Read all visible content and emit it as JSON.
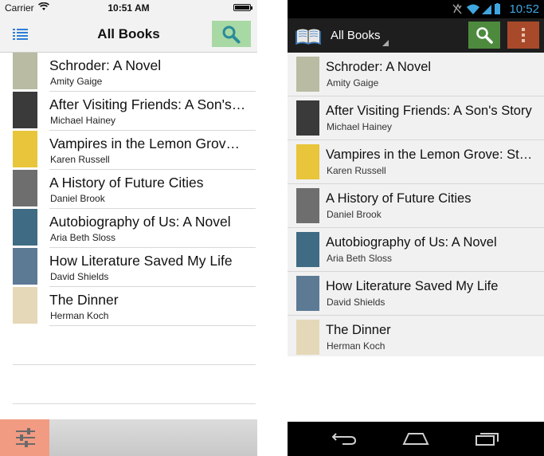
{
  "ios": {
    "status": {
      "carrier": "Carrier",
      "time": "10:51 AM"
    },
    "nav": {
      "title": "All Books"
    },
    "books": [
      {
        "title": "Schroder: A Novel",
        "author": "Amity Gaige",
        "cover_color": "#b9bba2"
      },
      {
        "title": "After Visiting Friends: A Son's Story",
        "author": "Michael Hainey",
        "cover_color": "#3a3a3a"
      },
      {
        "title": "Vampires in the Lemon Grove: Stories",
        "author": "Karen Russell",
        "cover_color": "#e8c53a"
      },
      {
        "title": "A History of Future Cities",
        "author": "Daniel Brook",
        "cover_color": "#6e6e6e"
      },
      {
        "title": "Autobiography of Us: A Novel",
        "author": "Aria Beth Sloss",
        "cover_color": "#3f6b84"
      },
      {
        "title": "How Literature Saved My Life",
        "author": "David Shields",
        "cover_color": "#5d7a95"
      },
      {
        "title": "The Dinner",
        "author": "Herman Koch",
        "cover_color": "#e5d8b8"
      }
    ]
  },
  "android": {
    "status": {
      "time": "10:52"
    },
    "actionbar": {
      "title": "All Books"
    },
    "books": [
      {
        "title": "Schroder: A Novel",
        "author": "Amity Gaige",
        "cover_color": "#b9bba2"
      },
      {
        "title": "After Visiting Friends: A Son's Story",
        "author": "Michael Hainey",
        "cover_color": "#3a3a3a"
      },
      {
        "title": "Vampires in the Lemon Grove: Stories",
        "author": "Karen Russell",
        "cover_color": "#e8c53a"
      },
      {
        "title": "A History of Future Cities",
        "author": "Daniel Brook",
        "cover_color": "#6e6e6e"
      },
      {
        "title": "Autobiography of Us: A Novel",
        "author": "Aria Beth Sloss",
        "cover_color": "#3f6b84"
      },
      {
        "title": "How Literature Saved My Life",
        "author": "David Shields",
        "cover_color": "#5d7a95"
      },
      {
        "title": "The Dinner",
        "author": "Herman Koch",
        "cover_color": "#e5d8b8"
      }
    ]
  },
  "colors": {
    "ios_search_button": "#a8d9a4",
    "ios_filter_button": "#f19b83",
    "android_search_button": "#4d8a3e",
    "android_overflow_button": "#a84a2a",
    "android_clock": "#3fa6e0"
  },
  "icons": {
    "ios_menu": "list-icon",
    "ios_search": "search-icon",
    "ios_filter": "sliders-icon",
    "android_app": "open-book-icon",
    "android_search": "search-icon",
    "android_overflow": "overflow-menu-icon",
    "android_back": "back-icon",
    "android_home": "home-icon",
    "android_recents": "recents-icon"
  }
}
